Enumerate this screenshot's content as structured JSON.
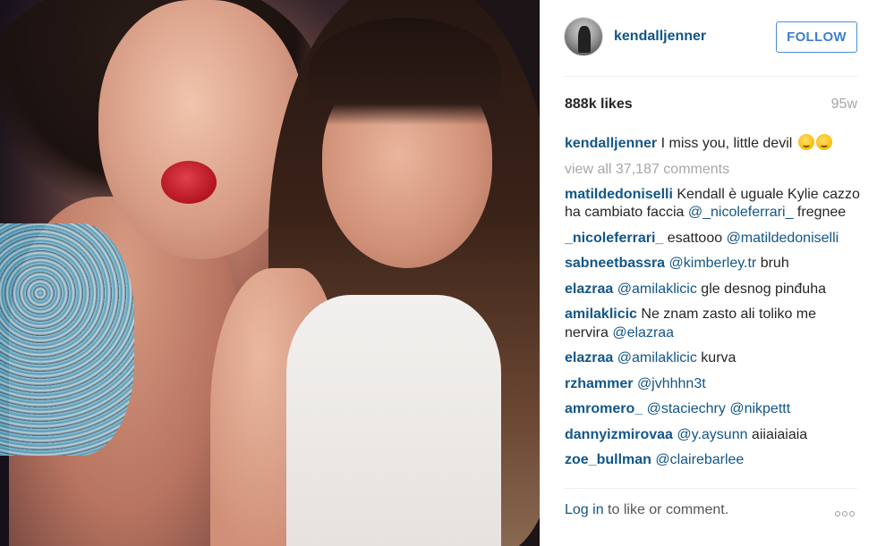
{
  "post": {
    "username": "kendalljenner",
    "follow_label": "FOLLOW",
    "likes": "888k likes",
    "age": "95w"
  },
  "caption": {
    "user": "kendalljenner",
    "text": " I miss you, little devil "
  },
  "view_all": "view all 37,187 comments",
  "comments": [
    {
      "user": "matildedoniselli",
      "pre": " Kendall è uguale Kylie cazzo ha cambiato faccia ",
      "mention": "@_nicoleferrari_",
      "post": " fregnee"
    },
    {
      "user": "_nicoleferrari_",
      "pre": " esattooo ",
      "mention": "@matildedoniselli",
      "post": ""
    },
    {
      "user": "sabneetbassra",
      "pre": " ",
      "mention": "@kimberley.tr",
      "post": " bruh"
    },
    {
      "user": "elazraa",
      "pre": " ",
      "mention": "@amilaklicic",
      "post": " gle desnog pinđuha"
    },
    {
      "user": "amilaklicic",
      "pre": " Ne znam zasto ali toliko me nervira ",
      "mention": "@elazraa",
      "post": ""
    },
    {
      "user": "elazraa",
      "pre": " ",
      "mention": "@amilaklicic",
      "post": " kurva"
    },
    {
      "user": "rzhammer",
      "pre": " ",
      "mention": "@jvhhhn3t",
      "post": ""
    },
    {
      "user": "amromero_",
      "pre": " ",
      "mention": "@staciechry @nikpettt",
      "post": ""
    },
    {
      "user": "dannyizmirovaa",
      "pre": " ",
      "mention": "@y.aysunn",
      "post": " aiiaiaiaia"
    },
    {
      "user": "zoe_bullman",
      "pre": " ",
      "mention": "@clairebarlee",
      "post": ""
    }
  ],
  "footer": {
    "login_link": "Log in",
    "login_rest": " to like or comment."
  },
  "icons": {
    "more": "more-options-icon",
    "emoji": "smiling-face-emoji-icon"
  },
  "colors": {
    "link": "#125688",
    "follow": "#3f7fcc",
    "muted": "#a5a7aa"
  }
}
